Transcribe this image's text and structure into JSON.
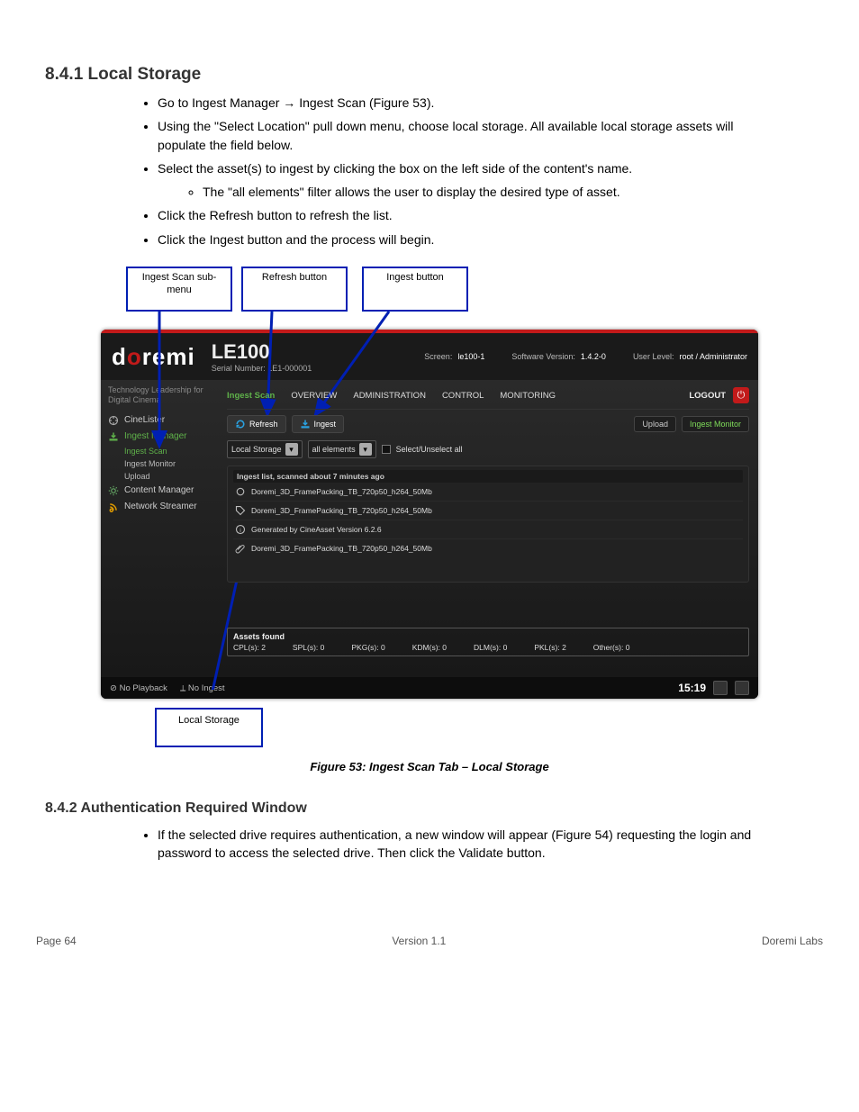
{
  "doc": {
    "section_title": "8.4.1 Local Storage",
    "bullets_top": [
      "Go to Ingest Manager → Ingest Scan (Figure 53).",
      "Using the \"Select Location\" pull down menu, choose local storage. All available local storage assets will populate the field below.",
      "Select the asset(s) to ingest by clicking the box on the left side of the content's name."
    ],
    "sub_bullet": "The \"all elements\" filter allows the user to display the desired type of asset.",
    "bullets_after_sub": [
      "Click the Refresh button to refresh the list.",
      "Click the Ingest button and the process will begin."
    ],
    "callouts": {
      "menu": "Ingest Scan sub-menu",
      "refresh": "Refresh button",
      "ingest": "Ingest button",
      "local": "Local Storage"
    },
    "caption": "Figure 53: Ingest Scan Tab – Local Storage",
    "subsection": "8.4.2 Authentication Required Window",
    "sub_bullets": [
      "If the selected drive requires authentication, a new window will appear (Figure 54) requesting the login and password to access the selected drive. Then click the Validate button."
    ],
    "footer_left": "Page 64",
    "footer_center": "Version 1.1",
    "footer_right": "Doremi Labs"
  },
  "ui": {
    "logo": {
      "d": "d",
      "o": "o",
      "remi": "remi"
    },
    "model": "LE100",
    "serial_label": "Serial Number: LE1-000001",
    "header_info": {
      "screen_label": "Screen:",
      "screen_value": "le100-1",
      "sw_label": "Software Version:",
      "sw_value": "1.4.2-0",
      "user_label": "User Level:",
      "user_value": "root / Administrator"
    },
    "sidebar": {
      "tagline": "Technology Leadership for Digital Cinema",
      "items": [
        {
          "label": "CineLister"
        },
        {
          "label": "Ingest Manager"
        },
        {
          "label": "Content Manager"
        },
        {
          "label": "Network Streamer"
        }
      ],
      "ingest_subs": [
        {
          "label": "Ingest Scan"
        },
        {
          "label": "Ingest Monitor"
        },
        {
          "label": "Upload"
        }
      ]
    },
    "tabs": [
      {
        "label": "Ingest Scan"
      },
      {
        "label": "OVERVIEW"
      },
      {
        "label": "ADMINISTRATION"
      },
      {
        "label": "CONTROL"
      },
      {
        "label": "MONITORING"
      }
    ],
    "logout": "LOGOUT",
    "toolbar": {
      "refresh": "Refresh",
      "ingest": "Ingest",
      "upload": "Upload",
      "monitor": "Ingest Monitor"
    },
    "filters": {
      "location": "Local Storage",
      "elements": "all elements",
      "select_all": "Select/Unselect all"
    },
    "list_header": "Ingest list, scanned about 7 minutes ago",
    "list_rows": [
      "Doremi_3D_FramePacking_TB_720p50_h264_50Mb",
      "Doremi_3D_FramePacking_TB_720p50_h264_50Mb",
      "Generated by CineAsset Version 6.2.6",
      "Doremi_3D_FramePacking_TB_720p50_h264_50Mb"
    ],
    "assets": {
      "title": "Assets found",
      "counts": [
        {
          "l": "CPL(s):",
          "v": "2"
        },
        {
          "l": "SPL(s):",
          "v": "0"
        },
        {
          "l": "PKG(s):",
          "v": "0"
        },
        {
          "l": "KDM(s):",
          "v": "0"
        },
        {
          "l": "DLM(s):",
          "v": "0"
        },
        {
          "l": "PKL(s):",
          "v": "2"
        },
        {
          "l": "Other(s):",
          "v": "0"
        }
      ]
    },
    "status": {
      "playback": "⊘ No Playback",
      "ingest": "⟂ No Ingest",
      "time": "15:19"
    }
  }
}
